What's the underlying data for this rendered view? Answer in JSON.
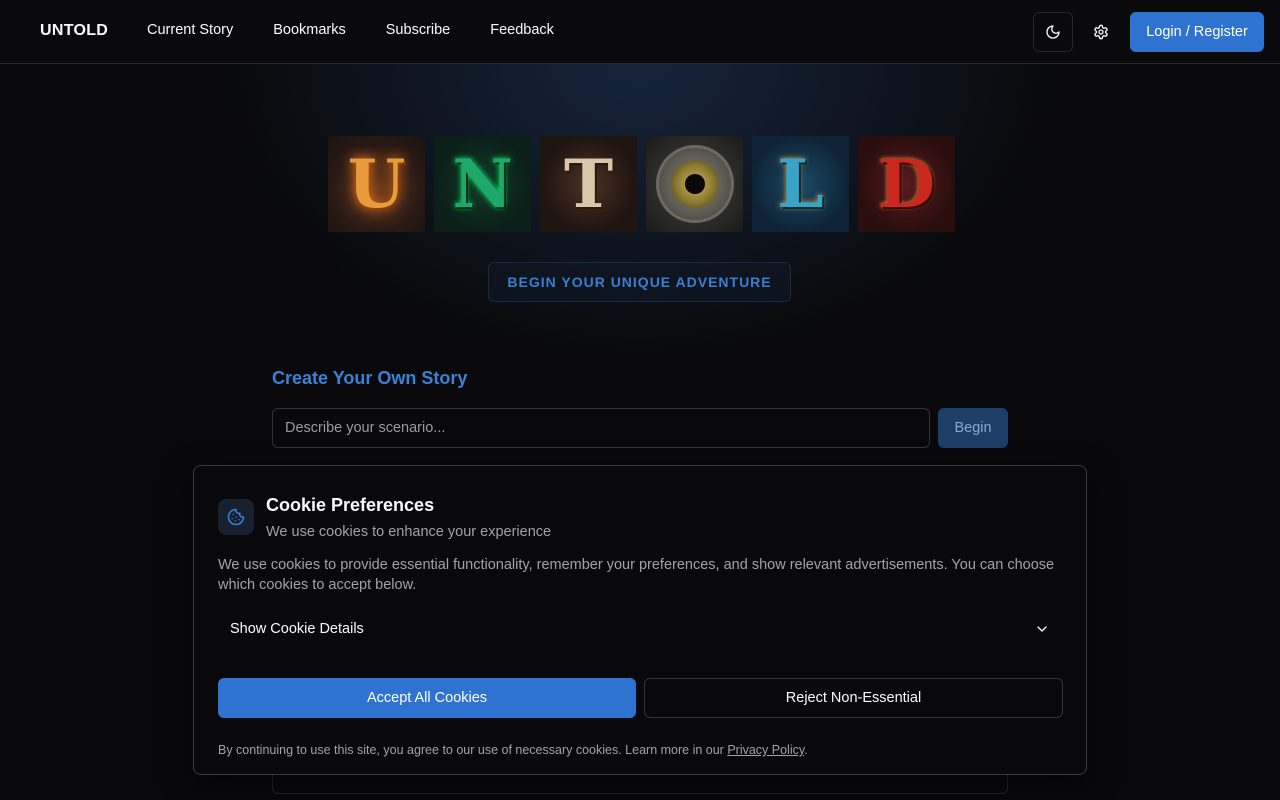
{
  "header": {
    "brand": "UNTOLD",
    "nav": [
      "Current Story",
      "Bookmarks",
      "Subscribe",
      "Feedback"
    ],
    "theme_icon": "moon-icon",
    "settings_icon": "gear-icon",
    "login_label": "Login / Register"
  },
  "logo": {
    "letters": [
      "U",
      "N",
      "T",
      "O",
      "L",
      "D"
    ]
  },
  "hero": {
    "tagline": "BEGIN YOUR UNIQUE ADVENTURE"
  },
  "create": {
    "title": "Create Your Own Story",
    "input_value": "",
    "input_placeholder": "Describe your scenario...",
    "begin_label": "Begin"
  },
  "cookie": {
    "icon": "cookie-icon",
    "title": "Cookie Preferences",
    "subtitle": "We use cookies to enhance your experience",
    "description": "We use cookies to provide essential functionality, remember your preferences, and show relevant advertisements. You can choose which cookies to accept below.",
    "details_label": "Show Cookie Details",
    "details_icon": "chevron-down-icon",
    "accept_label": "Accept All Cookies",
    "reject_label": "Reject Non-Essential",
    "footer_text": "By continuing to use this site, you agree to our use of necessary cookies. Learn more in our ",
    "footer_link": "Privacy Policy",
    "footer_end": "."
  },
  "colors": {
    "accent": "#2f73d1",
    "background": "#09090b",
    "heading_blue": "#3a82d6"
  }
}
